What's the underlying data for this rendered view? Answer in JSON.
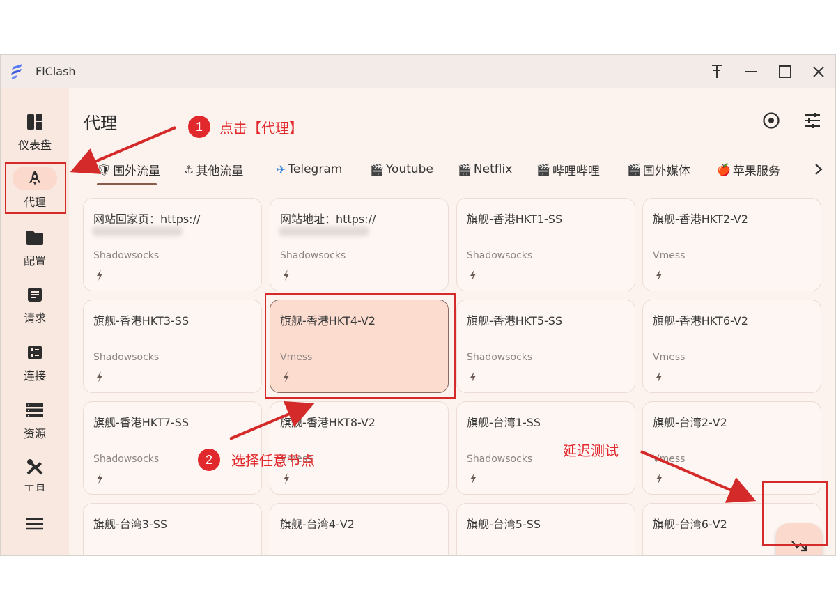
{
  "window": {
    "title": "FlClash",
    "controls": [
      "pin-icon",
      "minimize-icon",
      "maximize-icon",
      "close-icon"
    ]
  },
  "sidebar": {
    "items": [
      {
        "label": "仪表盘",
        "icon": "dashboard-icon"
      },
      {
        "label": "代理",
        "icon": "rocket-icon",
        "active": true
      },
      {
        "label": "配置",
        "icon": "folder-icon"
      },
      {
        "label": "请求",
        "icon": "request-icon"
      },
      {
        "label": "连接",
        "icon": "connection-icon"
      },
      {
        "label": "资源",
        "icon": "resources-icon"
      },
      {
        "label": "工具",
        "icon": "tools-icon"
      }
    ],
    "menu_icon": "menu-icon"
  },
  "header": {
    "title": "代理",
    "actions": [
      "target-icon",
      "tune-icon"
    ]
  },
  "tabs": [
    {
      "label": "国外流量",
      "icon": "🛡",
      "active": true
    },
    {
      "label": "其他流量",
      "icon": "⚓"
    },
    {
      "label": "Telegram",
      "icon": "✈"
    },
    {
      "label": "Youtube",
      "icon": "🎬"
    },
    {
      "label": "Netflix",
      "icon": "🎬"
    },
    {
      "label": "哔哩哔哩",
      "icon": "🎬"
    },
    {
      "label": "国外媒体",
      "icon": "🎬"
    },
    {
      "label": "苹果服务",
      "icon": "🍎"
    }
  ],
  "tabs_scroll_icon": "chevron-right-icon",
  "proxies": [
    {
      "name": "网站回家页：https://",
      "type": "Shadowsocks",
      "blurred": true
    },
    {
      "name": "网站地址：https://",
      "type": "Shadowsocks",
      "blurred": true
    },
    {
      "name": "旗舰-香港HKT1-SS",
      "type": "Shadowsocks"
    },
    {
      "name": "旗舰-香港HKT2-V2",
      "type": "Vmess"
    },
    {
      "name": "旗舰-香港HKT3-SS",
      "type": "Shadowsocks"
    },
    {
      "name": "旗舰-香港HKT4-V2",
      "type": "Vmess",
      "selected": true
    },
    {
      "name": "旗舰-香港HKT5-SS",
      "type": "Shadowsocks"
    },
    {
      "name": "旗舰-香港HKT6-V2",
      "type": "Vmess"
    },
    {
      "name": "旗舰-香港HKT7-SS",
      "type": "Shadowsocks"
    },
    {
      "name": "旗舰-香港HKT8-V2",
      "type": "Vmess"
    },
    {
      "name": "旗舰-台湾1-SS",
      "type": "Shadowsocks"
    },
    {
      "name": "旗舰-台湾2-V2",
      "type": "Vmess"
    },
    {
      "name": "旗舰-台湾3-SS",
      "type": ""
    },
    {
      "name": "旗舰-台湾4-V2",
      "type": ""
    },
    {
      "name": "旗舰-台湾5-SS",
      "type": ""
    },
    {
      "name": "旗舰-台湾6-V2",
      "type": ""
    }
  ],
  "fab": {
    "icon": "latency-test-icon"
  },
  "annotations": {
    "step1_number": "1",
    "step1_text": "点击【代理】",
    "step2_number": "2",
    "step2_text": "选择任意节点",
    "latency_text": "延迟测试"
  },
  "colors": {
    "accent": "#fbd9cc",
    "annotation_red": "#e0282d",
    "sidebar_bg": "#f8e8e0",
    "content_bg": "#fdf3ee"
  }
}
